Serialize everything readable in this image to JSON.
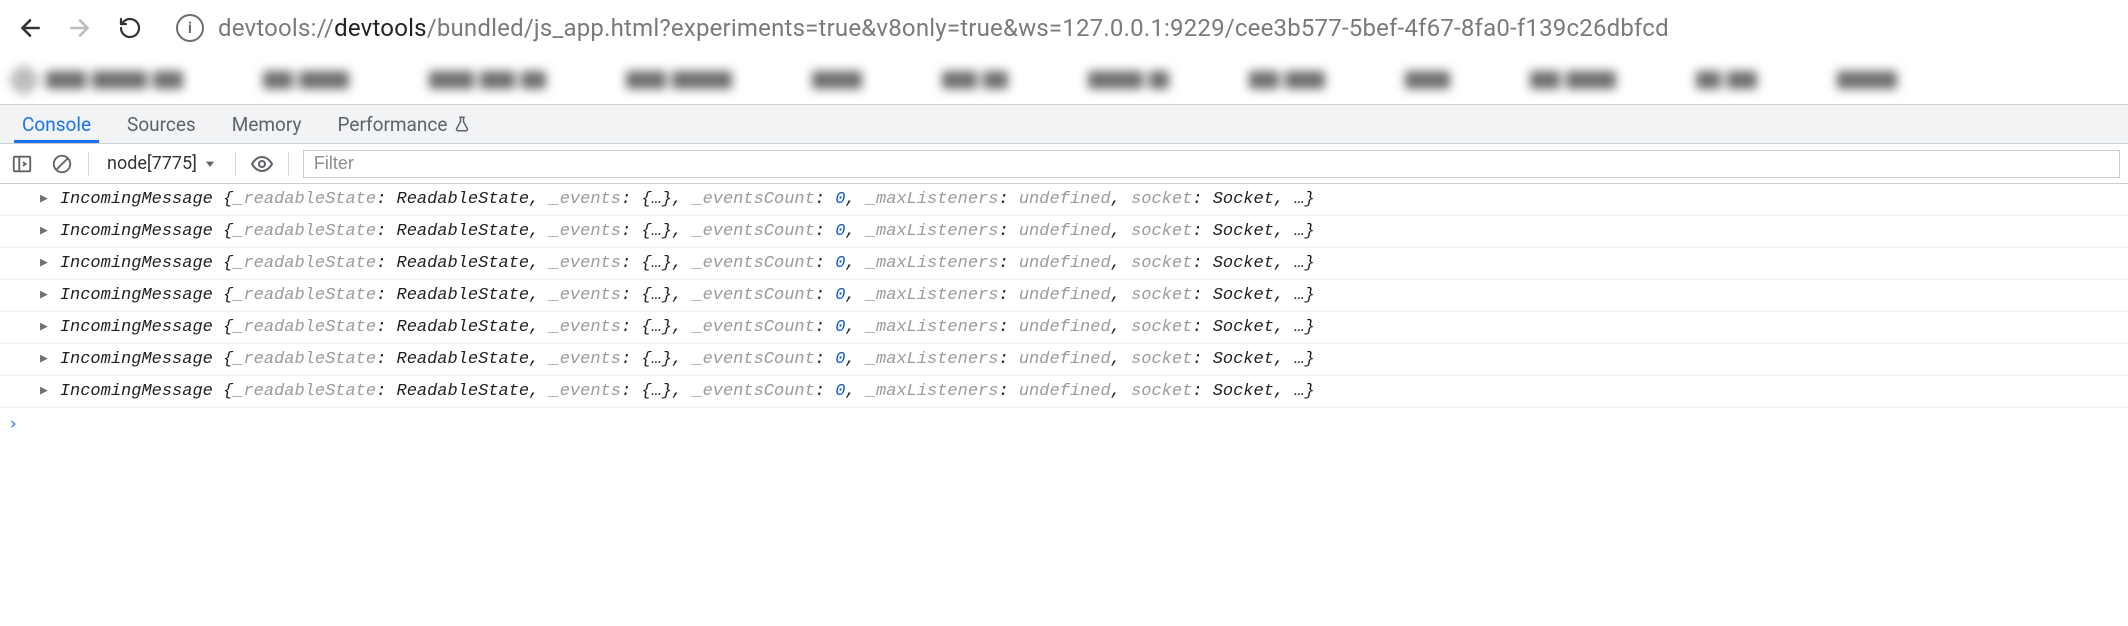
{
  "nav": {
    "url_prefix": "devtools",
    "url_mid_gray1": "://",
    "url_mid_dark": "devtools",
    "url_rest": "/bundled/js_app.html?experiments=true&v8only=true&ws=127.0.0.1:9229/cee3b577-5bef-4f67-8fa0-f139c26dbfcd",
    "info_char": "i"
  },
  "tabs": {
    "console": "Console",
    "sources": "Sources",
    "memory": "Memory",
    "performance": "Performance"
  },
  "toolbar": {
    "context": "node[7775]",
    "filter_placeholder": "Filter"
  },
  "log": {
    "class_name": "IncomingMessage",
    "open_brace": " {",
    "close_brace": "}",
    "comma": ", ",
    "colon": ": ",
    "ellipsis": "…",
    "props": [
      {
        "key": "_readableState",
        "val": "ReadableState",
        "kind": "val"
      },
      {
        "key": "_events",
        "val": "{…}",
        "kind": "val"
      },
      {
        "key": "_eventsCount",
        "val": "0",
        "kind": "num"
      },
      {
        "key": "_maxListeners",
        "val": "undefined",
        "kind": "undef"
      },
      {
        "key": "socket",
        "val": "Socket",
        "kind": "val"
      }
    ],
    "row_count": 7
  },
  "prompt": {
    "chevron": "›"
  }
}
